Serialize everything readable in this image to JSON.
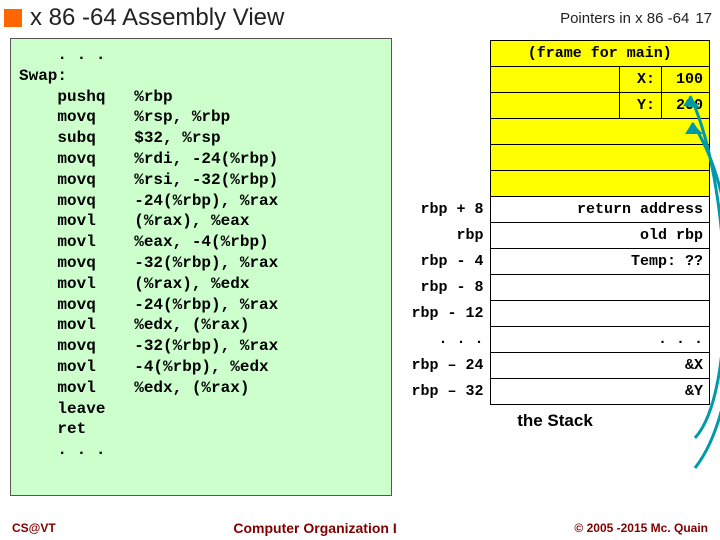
{
  "header": {
    "title": "x 86 -64 Assembly View",
    "subtitle": "Pointers in x 86 -64",
    "page": "17"
  },
  "code": "    . . .\nSwap:\n    pushq   %rbp\n    movq    %rsp, %rbp\n    subq    $32, %rsp\n    movq    %rdi, -24(%rbp)\n    movq    %rsi, -32(%rbp)\n    movq    -24(%rbp), %rax\n    movl    (%rax), %eax\n    movl    %eax, -4(%rbp)\n    movq    -32(%rbp), %rax\n    movl    (%rax), %edx\n    movq    -24(%rbp), %rax\n    movl    %edx, (%rax)\n    movq    -32(%rbp), %rax\n    movl    -4(%rbp), %edx\n    movl    %edx, (%rax)\n    leave\n    ret\n    . . .",
  "stack": {
    "frame_header": "(frame for main)",
    "rows": [
      {
        "label": "",
        "key": "X:",
        "val": "100",
        "yellow": true,
        "split": true
      },
      {
        "label": "",
        "key": "Y:",
        "val": "200",
        "yellow": true,
        "split": true
      },
      {
        "label": "",
        "text": "",
        "yellow": true
      },
      {
        "label": "",
        "text": "",
        "yellow": true
      },
      {
        "label": "",
        "text": "",
        "yellow": true
      },
      {
        "label": "rbp + 8",
        "text": "return address",
        "yellow": false
      },
      {
        "label": "rbp",
        "text": "old rbp",
        "yellow": false
      },
      {
        "label": "rbp -  4",
        "text": "Temp:  ??",
        "yellow": false
      },
      {
        "label": "rbp -  8",
        "text": "",
        "yellow": false
      },
      {
        "label": "rbp - 12",
        "text": "",
        "yellow": false
      },
      {
        "label": ". . .",
        "text": ". . .",
        "yellow": false
      },
      {
        "label": "rbp – 24",
        "text": "&X",
        "yellow": false
      },
      {
        "label": "rbp – 32",
        "text": "&Y",
        "yellow": false
      }
    ],
    "caption": "the Stack"
  },
  "footer": {
    "left": "CS@VT",
    "center": "Computer Organization I",
    "right": "© 2005 -2015 Mc. Quain"
  }
}
